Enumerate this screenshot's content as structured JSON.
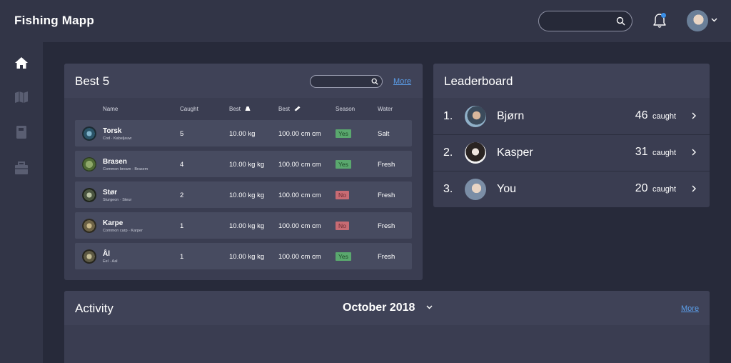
{
  "app": {
    "title": "Fishing Mapp"
  },
  "header": {
    "search_placeholder": "",
    "icons": {
      "search": "search-icon",
      "notifications": "bell-icon",
      "user": "avatar",
      "caret": "chevron-down-icon"
    },
    "notification_dot_color": "#3a8ee6"
  },
  "sidebar": {
    "items": [
      {
        "icon": "home-icon",
        "active": true
      },
      {
        "icon": "map-icon",
        "active": false
      },
      {
        "icon": "book-icon",
        "active": false
      },
      {
        "icon": "tackle-box-icon",
        "active": false
      }
    ]
  },
  "best5": {
    "title": "Best 5",
    "more_label": "More",
    "search_placeholder": "",
    "columns": [
      "Name",
      "Caught",
      "Best",
      "Best",
      "Season",
      "Water"
    ],
    "rows": [
      {
        "name": "Torsk",
        "sub": "Cod  ·  Kabeljauw",
        "caught": "5",
        "weight": "10.00 kg",
        "length": "100.00 cm cm",
        "season": "Yes",
        "water": "Salt"
      },
      {
        "name": "Brasen",
        "sub": "Common bream  ·  Brasem",
        "caught": "4",
        "weight": "10.00 kg kg",
        "length": "100.00 cm cm",
        "season": "Yes",
        "water": "Fresh"
      },
      {
        "name": "Stør",
        "sub": "Sturgeon  ·  Steur",
        "caught": "2",
        "weight": "10.00 kg kg",
        "length": "100.00 cm cm",
        "season": "No",
        "water": "Fresh"
      },
      {
        "name": "Karpe",
        "sub": "Common carp  ·  Karper",
        "caught": "1",
        "weight": "10.00 kg kg",
        "length": "100.00 cm cm",
        "season": "No",
        "water": "Fresh"
      },
      {
        "name": "Ål",
        "sub": "Eel  ·  Aal",
        "caught": "1",
        "weight": "10.00 kg kg",
        "length": "100.00 cm cm",
        "season": "Yes",
        "water": "Fresh"
      }
    ]
  },
  "leaderboard": {
    "title": "Leaderboard",
    "unit": "caught",
    "entries": [
      {
        "rank": "1.",
        "name": "Bjørn",
        "count": "46"
      },
      {
        "rank": "2.",
        "name": "Kasper",
        "count": "31"
      },
      {
        "rank": "3.",
        "name": "You",
        "count": "20"
      }
    ]
  },
  "activity": {
    "title": "Activity",
    "month": "October 2018",
    "more_label": "More"
  }
}
